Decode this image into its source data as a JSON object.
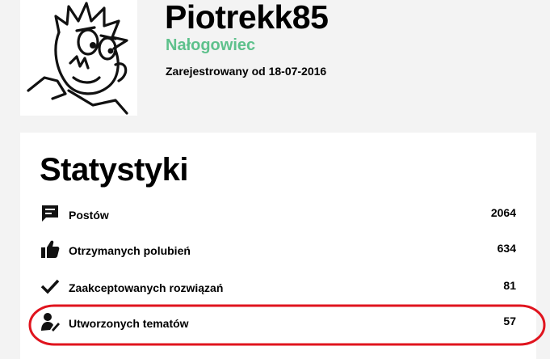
{
  "profile": {
    "username": "Piotrekk85",
    "rank": "Nałogowiec",
    "registered": "Zarejestrowany od 18-07-2016",
    "avatar_icon": "cartoon-face-avatar",
    "rank_color": "#5ec18c"
  },
  "stats": {
    "title": "Statystyki",
    "rows": [
      {
        "icon": "comment-icon",
        "label": "Postów",
        "value": "2064"
      },
      {
        "icon": "thumbs-up-icon",
        "label": "Otrzymanych polubień",
        "value": "634"
      },
      {
        "icon": "checkmark-icon",
        "label": "Zaakceptowanych rozwiązań",
        "value": "81"
      },
      {
        "icon": "user-edit-icon",
        "label": "Utworzonych tematów",
        "value": "57"
      }
    ]
  },
  "annotation": {
    "color": "#e0141e"
  }
}
